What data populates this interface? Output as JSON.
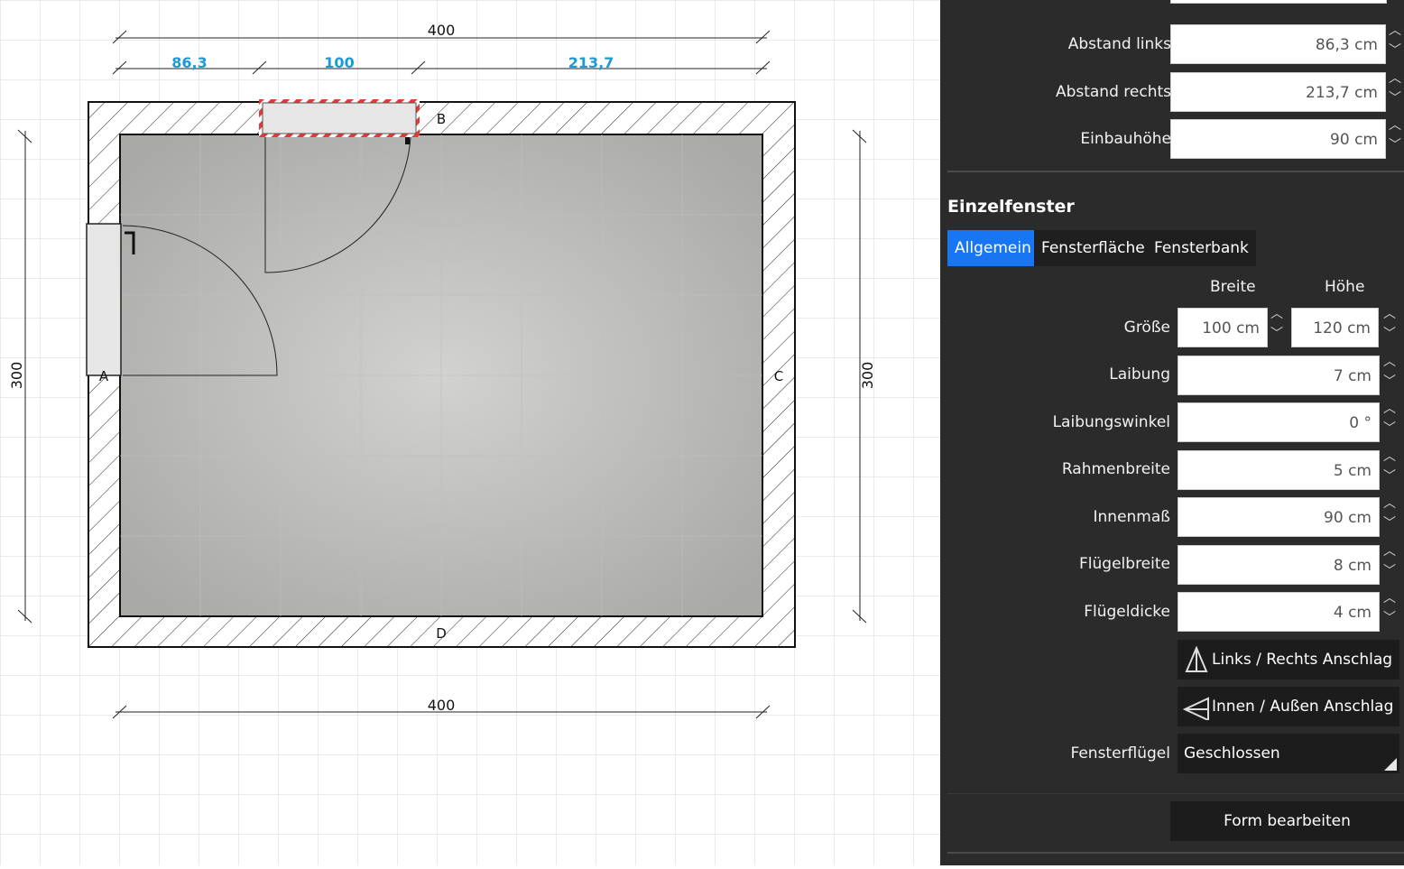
{
  "plan": {
    "dim_top_total": "400",
    "dim_top_left": "86,3",
    "dim_top_window": "100",
    "dim_top_right": "213,7",
    "dim_bottom": "400",
    "dim_left": "300",
    "dim_right": "300",
    "wall_a": "A",
    "wall_b": "B",
    "wall_c": "C",
    "wall_d": "D",
    "colors": {
      "dimension_highlight": "#1a9bd7",
      "selection": "#e53935"
    }
  },
  "panel": {
    "abstand_links_label": "Abstand links",
    "abstand_links_value": "86,3 cm",
    "abstand_rechts_label": "Abstand rechts",
    "abstand_rechts_value": "213,7 cm",
    "einbauhoehe_label": "Einbauhöhe",
    "einbauhoehe_value": "90 cm",
    "section_title": "Einzelfenster",
    "tabs": [
      "Allgemein",
      "Fensterfläche",
      "Fensterbank"
    ],
    "col_breite": "Breite",
    "col_hoehe": "Höhe",
    "groesse_label": "Größe",
    "groesse_breite": "100 cm",
    "groesse_hoehe": "120 cm",
    "laibung_label": "Laibung",
    "laibung_value": "7 cm",
    "laibungswinkel_label": "Laibungswinkel",
    "laibungswinkel_value": "0 °",
    "rahmenbreite_label": "Rahmenbreite",
    "rahmenbreite_value": "5 cm",
    "innenmass_label": "Innenmaß",
    "innenmass_value": "90 cm",
    "fluegelbreite_label": "Flügelbreite",
    "fluegelbreite_value": "8 cm",
    "fluegeldicke_label": "Flügeldicke",
    "fluegeldicke_value": "4 cm",
    "btn_lr_anschlag": "Links / Rechts Anschlag",
    "btn_ia_anschlag": "Innen / Außen Anschlag",
    "fensterfluegel_label": "Fensterflügel",
    "fensterfluegel_value": "Geschlossen",
    "btn_form": "Form bearbeiten",
    "colors": {
      "panel_bg": "#2b2b2b",
      "active_tab": "#1976f2"
    }
  }
}
